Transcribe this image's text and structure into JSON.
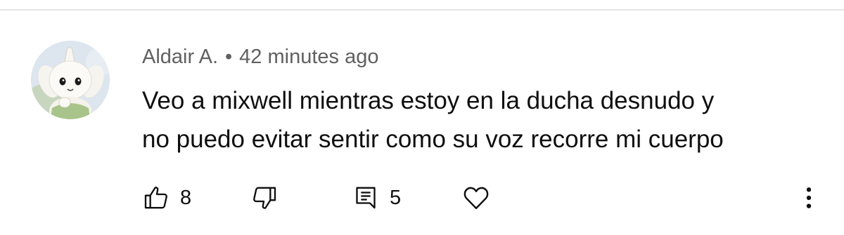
{
  "comment": {
    "author": "Aldair A.",
    "separator": "•",
    "timestamp": "42 minutes ago",
    "text_lines": [
      "Veo a mixwell mientras estoy en la ducha desnudo y",
      "no puedo evitar sentir como su voz recorre mi cuerpo"
    ],
    "avatar_icon": "cartoon-character-avatar"
  },
  "actions": {
    "like_count": "8",
    "reply_count": "5",
    "like_icon": "thumbs-up-icon",
    "dislike_icon": "thumbs-down-icon",
    "reply_icon": "comment-replies-icon",
    "heart_icon": "heart-icon",
    "more_icon": "more-vertical-icon"
  },
  "colors": {
    "text_primary": "#0f0f0f",
    "text_secondary": "#606060",
    "divider": "#e5e5e5"
  }
}
